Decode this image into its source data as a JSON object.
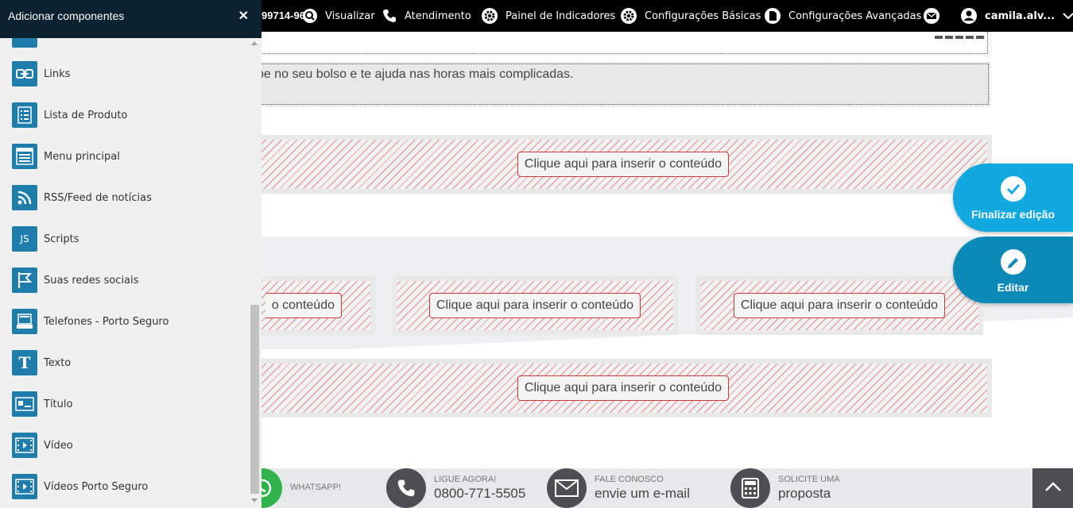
{
  "topbar": {
    "phone_fragment": "99714-96",
    "nav": [
      {
        "label": "Visualizar",
        "icon": "search-icon"
      },
      {
        "label": "Atendimento",
        "icon": "phone-icon"
      },
      {
        "label": "Painel de Indicadores",
        "icon": "gear-icon"
      },
      {
        "label": "Configurações Básicas",
        "icon": "gear-icon"
      },
      {
        "label": "Configurações Avançadas",
        "icon": "document-icon"
      },
      {
        "label": "",
        "icon": "mail-icon"
      },
      {
        "label": "camila.alv...",
        "icon": "user-icon"
      }
    ]
  },
  "content": {
    "text_fragment": "be no seu bolso e te ajuda nas horas mais complicadas.",
    "placeholders": [
      "Clique aqui para inserir o conteúdo",
      "Clique aqui para inserir o conteúdo",
      "Clique aqui para inserir o conteúdo",
      "Clique aqui para inserir o conteúdo",
      "Clique aqui para inserir o conteúdo"
    ],
    "partial_placeholder": "o conteúdo"
  },
  "actions": {
    "finalize": "Finalizar edição",
    "edit": "Editar"
  },
  "footer": {
    "whatsapp": {
      "small": "WHATSAPP!",
      "big": ""
    },
    "call": {
      "small": "LIGUE AGORA!",
      "big": "0800-771-5505"
    },
    "contact": {
      "small": "FALE CONOSCO",
      "big": "envie um e-mail"
    },
    "quote": {
      "small": "SOLICITE UMA",
      "big": "proposta"
    }
  },
  "panel": {
    "title": "Adicionar componentes",
    "items": [
      {
        "label": "Links",
        "icon": "link-icon"
      },
      {
        "label": "Lista de Produto",
        "icon": "list-icon"
      },
      {
        "label": "Menu principal",
        "icon": "menu-icon"
      },
      {
        "label": "RSS/Feed de notícias",
        "icon": "rss-icon"
      },
      {
        "label": "Scripts",
        "icon": "js-icon"
      },
      {
        "label": "Suas redes sociais",
        "icon": "flag-icon"
      },
      {
        "label": "Telefones - Porto Seguro",
        "icon": "phone-book-icon"
      },
      {
        "label": "Texto",
        "icon": "text-icon"
      },
      {
        "label": "Título",
        "icon": "title-icon"
      },
      {
        "label": "Vídeo",
        "icon": "video-icon"
      },
      {
        "label": "Vídeos Porto Seguro",
        "icon": "video-icon"
      }
    ]
  },
  "colors": {
    "accent": "#12a9e0",
    "edit": "#0b8ab8",
    "panel_icon": "#1e7dab",
    "panel_header": "#0c2230"
  }
}
